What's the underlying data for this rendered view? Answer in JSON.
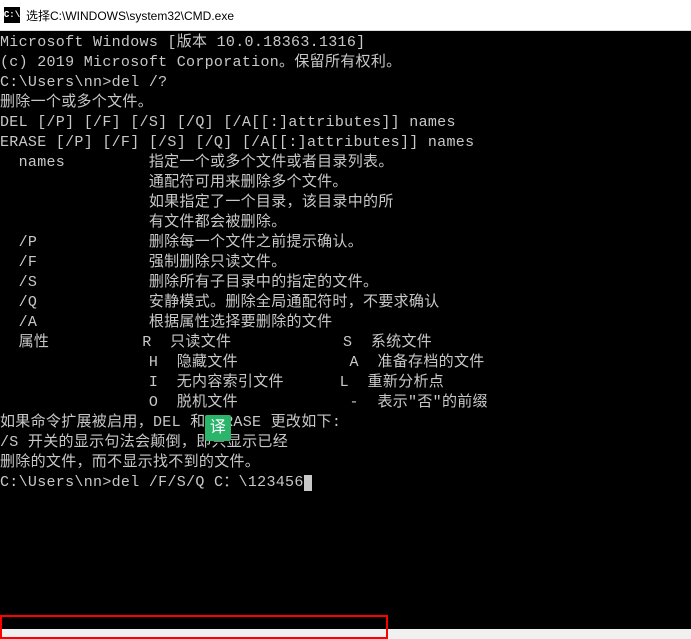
{
  "titlebar": {
    "icon_text": "C:\\",
    "title": "选择C:\\WINDOWS\\system32\\CMD.exe"
  },
  "translate": {
    "label": "译"
  },
  "lines": {
    "l0": "Microsoft Windows [版本 10.0.18363.1316]",
    "l1": "(c) 2019 Microsoft Corporation。保留所有权利。",
    "l2": "",
    "l3": "C:\\Users\\nn>del /?",
    "l4": "删除一个或多个文件。",
    "l5": "",
    "l6": "DEL [/P] [/F] [/S] [/Q] [/A[[:]attributes]] names",
    "l7": "ERASE [/P] [/F] [/S] [/Q] [/A[[:]attributes]] names",
    "l8": "",
    "l9": "  names         指定一个或多个文件或者目录列表。",
    "l10": "                通配符可用来删除多个文件。",
    "l11": "                如果指定了一个目录，该目录中的所",
    "l12": "                有文件都会被删除。",
    "l13": "",
    "l14": "  /P            删除每一个文件之前提示确认。",
    "l15": "  /F            强制删除只读文件。",
    "l16": "  /S            删除所有子目录中的指定的文件。",
    "l17": "  /Q            安静模式。删除全局通配符时，不要求确认",
    "l18": "  /A            根据属性选择要删除的文件",
    "l19": "  属性          R  只读文件            S  系统文件",
    "l20": "                H  隐藏文件            A  准备存档的文件",
    "l21": "                I  无内容索引文件      L  重新分析点",
    "l22": "                O  脱机文件            -  表示\"否\"的前缀",
    "l23": "",
    "l24": "如果命令扩展被启用，DEL 和 ERASE 更改如下:",
    "l25": "",
    "l26": "/S 开关的显示句法会颠倒，即只显示已经",
    "l27": "删除的文件，而不显示找不到的文件。",
    "l28": ""
  },
  "prompt": {
    "prefix": "C:\\Users\\nn>",
    "command": "del /F/S/Q C：\\123456"
  }
}
